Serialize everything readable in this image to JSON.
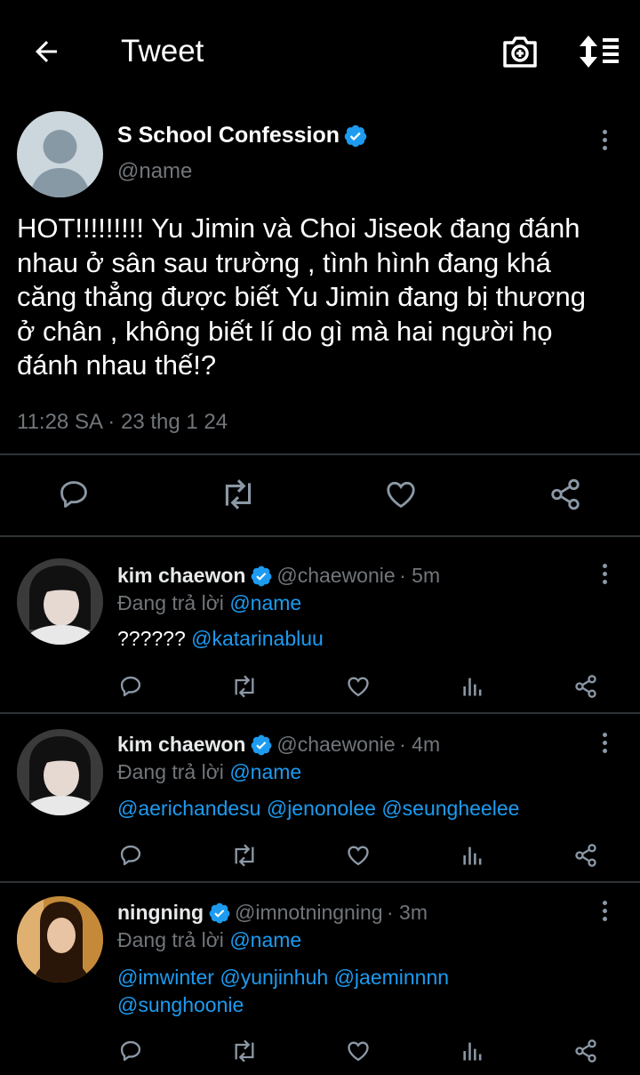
{
  "header": {
    "title": "Tweet",
    "back_icon": "arrow-left-icon",
    "camera_icon": "camera-plus-icon",
    "sort_icon": "sort-list-icon"
  },
  "main_tweet": {
    "display_name": "S School Confession",
    "handle": "@name",
    "text_lines": [
      "HOT!!!!!!!!! Yu Jimin và Choi Jiseok đang đánh",
      "nhau ở sân sau trường , tình hình đang khá",
      "căng thẳng được biết Yu Jimin đang bị thương",
      "ở chân , không biết lí do gì mà hai người họ",
      "đánh nhau thế!?"
    ],
    "timestamp": "11:28 SA · 23 thg 1 24",
    "actions": [
      "reply-icon",
      "retweet-icon",
      "like-icon",
      "share-icon"
    ]
  },
  "replies": [
    {
      "display_name": "kim chaewon",
      "handle": "@chaewonie",
      "time": "· 5m",
      "replying_label": "Đang trả lời",
      "replying_to": "@name",
      "text_prefix": "?????? ",
      "mentions_line1": "@katarinabluu",
      "mentions_line2": ""
    },
    {
      "display_name": "kim chaewon",
      "handle": "@chaewonie",
      "time": "· 4m",
      "replying_label": "Đang trả lời",
      "replying_to": "@name",
      "text_prefix": "",
      "mentions_line1": "@aerichandesu @jenonolee @seungheelee",
      "mentions_line2": ""
    },
    {
      "display_name": "ningning",
      "handle": "@imnotningning",
      "time": "· 3m",
      "replying_label": "Đang trả lời",
      "replying_to": "@name",
      "text_prefix": "",
      "mentions_line1": "@imwinter @yunjinhuh @jaeminnnn",
      "mentions_line2": "@sunghoonie"
    }
  ],
  "colors": {
    "background": "#000000",
    "accent": "#1d9bf0",
    "muted": "#71767b",
    "divider": "#2f3336"
  }
}
